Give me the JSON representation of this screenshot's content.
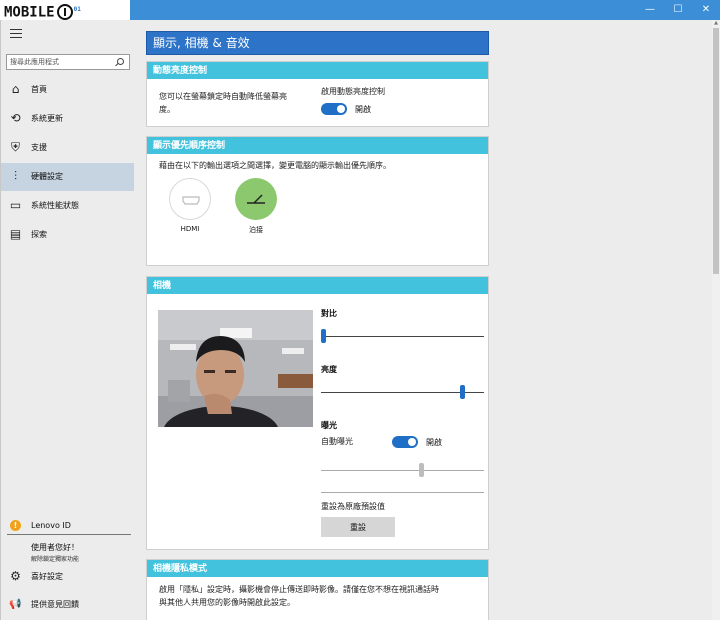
{
  "titlebar": {
    "logo_text": "MOBILE",
    "logo_sub": "01",
    "min_icon": "—",
    "max_icon": "☐",
    "close_icon": "✕"
  },
  "sidebar": {
    "search_placeholder": "搜尋此應用程式",
    "items": [
      {
        "label": "首頁",
        "icon": "⌂"
      },
      {
        "label": "系統更新",
        "icon": "⟲"
      },
      {
        "label": "支援",
        "icon": "⛨"
      },
      {
        "label": "硬體設定",
        "icon": "⫶"
      },
      {
        "label": "系統性能狀態",
        "icon": "▭"
      },
      {
        "label": "探索",
        "icon": "▤"
      }
    ],
    "active_index": 3,
    "lenovo_id": "Lenovo ID",
    "lenovo_icon": "!",
    "greeting": "使用者您好！",
    "unlock_text": "解除鎖定獨家功能",
    "preferences": "喜好設定",
    "preferences_icon": "⚙",
    "feedback": "提供意見回饋",
    "feedback_icon": "📢"
  },
  "main": {
    "page_title": "顯示, 相機 & 音效",
    "brightness": {
      "header": "動態亮度控制",
      "description_line1": "您可以在螢幕鎖定時自動降低螢幕亮",
      "description_line2": "度。",
      "toggle_label": "啟用動態亮度控制",
      "toggle_state": "開啟"
    },
    "priority": {
      "header": "顯示優先順序控制",
      "description": "藉由在以下的輸出選項之間選擇，變更電腦的顯示輸出優先順序。",
      "options": [
        {
          "label": "HDMI",
          "icon": "hdmi-icon"
        },
        {
          "label": "泊接",
          "icon": "dock-icon"
        }
      ]
    },
    "camera": {
      "header": "相機",
      "contrast_label": "對比",
      "contrast_value": 0.0,
      "brightness_label": "亮度",
      "brightness_value": 0.88,
      "exposure_label": "曝光",
      "auto_exposure_label": "自動曝光",
      "auto_exposure_state": "開啟",
      "exposure_value": 0.62,
      "reset_label": "重設為原廠預設值",
      "reset_button": "重設"
    },
    "privacy": {
      "header": "相機隱私模式",
      "description_line1": "啟用「隱私」設定時，攝影機會停止傳送即時影像。請僅在您不想在視訊通話時",
      "description_line2": "與其他人共用您的影像時開啟此設定。"
    }
  },
  "colors": {
    "titlebar": "#3c8fd6",
    "page_title": "#2d73c8",
    "card_header": "#43c2dd",
    "toggle_on": "#1f6fc7",
    "dock_green": "#8cc96e",
    "sidebar_active": "#c6d3e0"
  }
}
